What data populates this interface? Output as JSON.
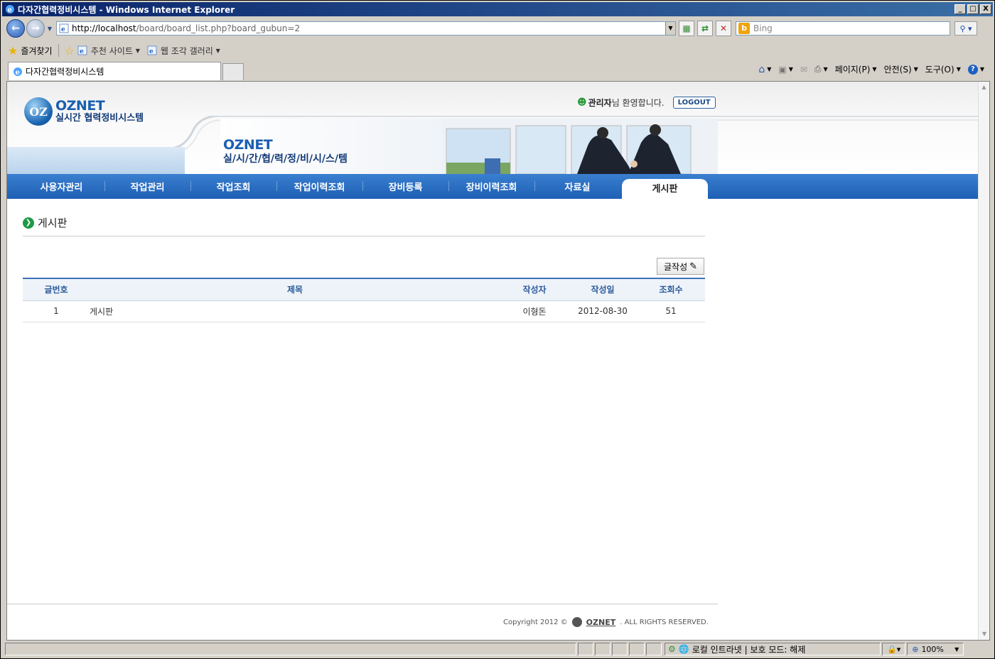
{
  "window": {
    "title": "다자간협력정비시스템 - Windows Internet Explorer",
    "minimize": "_",
    "maximize": "□",
    "close": "X"
  },
  "browser": {
    "url_host": "http://localhost",
    "url_path": "/board/board_list.php?board_gubun=2",
    "search_placeholder": "Bing",
    "favorites_label": "즐겨찾기",
    "fav_items": [
      "추천 사이트",
      "웹 조각 갤러리"
    ],
    "tab_title": "다자간협력정비시스템",
    "commands": {
      "page": "페이지(P)",
      "safety": "안전(S)",
      "tools": "도구(O)"
    }
  },
  "site": {
    "logo_brand": "OZNET",
    "logo_sub": "실시간 협력정비시스템",
    "banner_brand": "OZNET",
    "banner_sub": "실/시/간/협/력/정/비/시/스/템",
    "user_name": "관리자",
    "welcome_suffix": "님 환영합니다.",
    "logout_label": "LOGOUT",
    "menu": [
      "사용자관리",
      "작업관리",
      "작업조회",
      "작업이력조회",
      "장비등록",
      "장비이력조회",
      "자료실",
      "게시판"
    ],
    "active_menu": "게시판"
  },
  "board": {
    "page_title": "게시판",
    "write_button": "글작성",
    "columns": {
      "no": "글번호",
      "title": "제목",
      "writer": "작성자",
      "date": "작성일",
      "hits": "조회수"
    },
    "rows": [
      {
        "no": "1",
        "title": "게시판",
        "writer": "이형돈",
        "date": "2012-08-30",
        "hits": "51"
      }
    ]
  },
  "footer": {
    "copyright": "Copyright 2012 ©",
    "brand": "OZNET",
    "rights": ". ALL RIGHTS RESERVED."
  },
  "status": {
    "zone": "로컬 인트라넷 | 보호 모드: 해제",
    "zoom": "100%"
  },
  "colors": {
    "menu_blue": "#1d5fb4",
    "brand_blue": "#1b5fb0",
    "bullet_green": "#1d9a44"
  }
}
